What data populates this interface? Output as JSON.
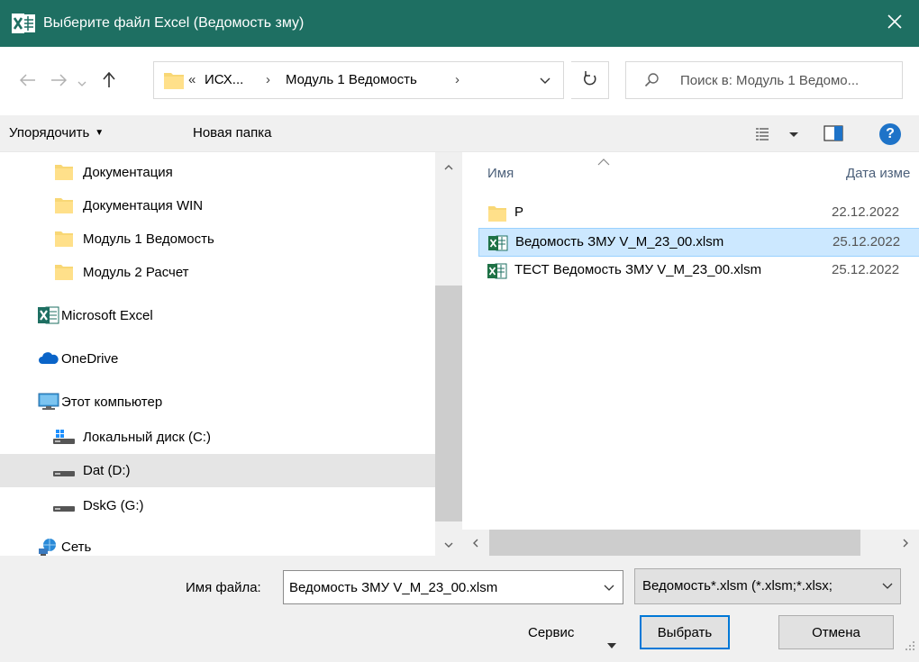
{
  "window": {
    "title": "Выберите файл Excel (Ведомость зму)",
    "title_icon": "excel-icon",
    "close_icon": "close-icon",
    "title_bar_color": "#1e6f62"
  },
  "navigation": {
    "back_icon": "arrow-left-icon",
    "forward_icon": "arrow-right-icon",
    "recent_icon": "chevron-down-icon",
    "up_icon": "arrow-up-icon",
    "address": {
      "overflow": "«",
      "segments": [
        "ИСХ...",
        "Модуль 1 Ведомость"
      ],
      "separator": "›"
    },
    "refresh_icon": "refresh-icon",
    "search_placeholder": "Поиск в: Модуль 1 Ведомо..."
  },
  "toolbar": {
    "organize_label": "Упорядочить",
    "new_folder_label": "Новая папка",
    "view_icon": "view-options-icon",
    "preview_icon": "preview-pane-icon",
    "help_label": "?"
  },
  "nav_pane": {
    "items": [
      {
        "label": "Документация",
        "icon": "folder-icon",
        "state": ""
      },
      {
        "label": "Документация WIN",
        "icon": "folder-icon",
        "state": ""
      },
      {
        "label": "Модуль 1 Ведомость",
        "icon": "folder-icon",
        "state": ""
      },
      {
        "label": "Модуль 2 Расчет",
        "icon": "folder-icon",
        "state": ""
      },
      {
        "label": "Microsoft Excel",
        "icon": "excel-icon",
        "state": ""
      },
      {
        "label": "OneDrive",
        "icon": "cloud-icon",
        "state": ""
      },
      {
        "label": "Этот компьютер",
        "icon": "computer-icon",
        "state": ""
      },
      {
        "label": "Локальный диск (C:)",
        "icon": "system-drive-icon",
        "state": ""
      },
      {
        "label": "Dat (D:)",
        "icon": "drive-icon",
        "state": "hover"
      },
      {
        "label": "DskG (G:)",
        "icon": "drive-icon",
        "state": ""
      },
      {
        "label": "Сеть",
        "icon": "network-icon",
        "state": ""
      }
    ]
  },
  "file_list": {
    "columns": {
      "name": "Имя",
      "date": "Дата изме"
    },
    "sort_icon": "sort-ascending-icon",
    "files": [
      {
        "name": "P",
        "date": "22.12.2022",
        "icon": "folder-icon",
        "selected": false
      },
      {
        "name": "Ведомость ЗМУ V_M_23_00.xlsm",
        "date": "25.12.2022",
        "icon": "excel-macro-file-icon",
        "selected": true
      },
      {
        "name": "ТЕСТ Ведомость ЗМУ V_M_23_00.xlsm",
        "date": "25.12.2022",
        "icon": "excel-macro-file-icon",
        "selected": false
      }
    ]
  },
  "footer": {
    "filename_label": "Имя файла:",
    "filename_value": "Ведомость ЗМУ V_M_23_00.xlsm",
    "filter_value": "Ведомость*.xlsm (*.xlsm;*.xlsx;",
    "service_label": "Сервис",
    "open_label": "Выбрать",
    "cancel_label": "Отмена"
  }
}
